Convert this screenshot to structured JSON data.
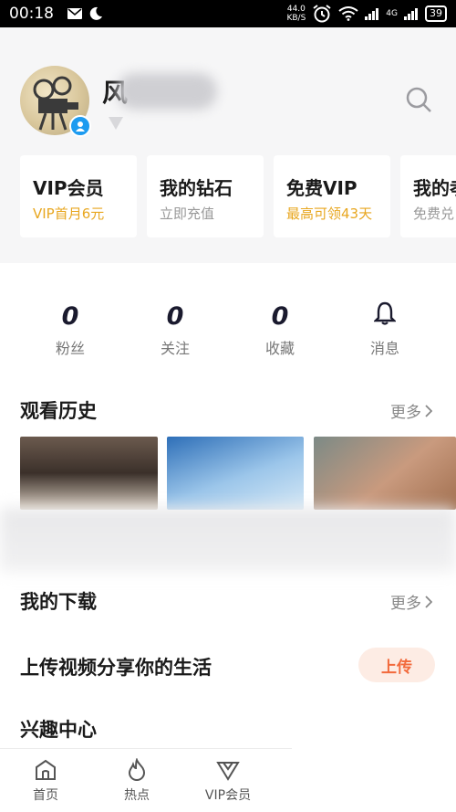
{
  "status_bar": {
    "time": "00:18",
    "net_speed_value": "44.0",
    "net_speed_unit": "KB/S",
    "network_type": "4G",
    "battery": "39"
  },
  "profile": {
    "username_visible": "风"
  },
  "cards": [
    {
      "title": "VIP会员",
      "subtitle": "VIP首月6元",
      "subtitle_color": "#e8a720"
    },
    {
      "title": "我的钻石",
      "subtitle": "立即充值",
      "subtitle_color": "#999999"
    },
    {
      "title": "免费VIP",
      "subtitle": "最高可领43天",
      "subtitle_color": "#e8a720"
    },
    {
      "title": "我的孝",
      "subtitle": "免费兑",
      "subtitle_color": "#999999"
    }
  ],
  "stats": [
    {
      "value": "0",
      "label": "粉丝"
    },
    {
      "value": "0",
      "label": "关注"
    },
    {
      "value": "0",
      "label": "收藏"
    },
    {
      "label": "消息",
      "icon": "bell-icon"
    }
  ],
  "history": {
    "title": "观看历史",
    "more": "更多"
  },
  "downloads": {
    "title": "我的下载",
    "more": "更多"
  },
  "upload": {
    "title": "上传视频分享你的生活",
    "button": "上传"
  },
  "interest": {
    "title": "兴趣中心"
  },
  "tabs": [
    {
      "label": "首页",
      "icon": "home-icon"
    },
    {
      "label": "热点",
      "icon": "flame-icon"
    },
    {
      "label": "VIP会员",
      "icon": "vip-diamond-icon"
    }
  ]
}
